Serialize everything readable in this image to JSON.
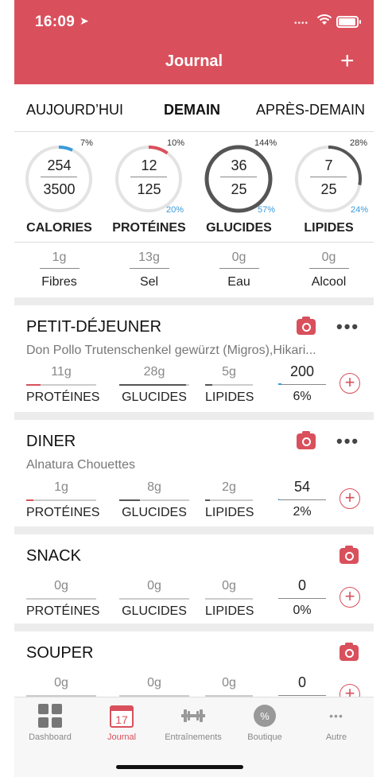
{
  "status": {
    "time": "16:09",
    "signal": "••••"
  },
  "header": {
    "title": "Journal",
    "add_label": "+"
  },
  "tabs": [
    {
      "label": "AUJOURD’HUI"
    },
    {
      "label": "DEMAIN"
    },
    {
      "label": "APRÈS-DEMAIN"
    }
  ],
  "colors": {
    "brand": "#d9505c",
    "accent_blue": "#3a9ad9",
    "ring_track": "#e3e3e3",
    "ring_full": "#555555"
  },
  "summary": [
    {
      "name": "CALORIES",
      "value": "254",
      "goal": "3500",
      "pct_top": "7%",
      "pct_bottom": "",
      "fraction": 0.07,
      "ring_color": "#3a9ad9"
    },
    {
      "name": "PROTÉINES",
      "value": "12",
      "goal": "125",
      "pct_top": "10%",
      "pct_bottom": "20%",
      "fraction": 0.1,
      "ring_color": "#d9505c"
    },
    {
      "name": "GLUCIDES",
      "value": "36",
      "goal": "25",
      "pct_top": "144%",
      "pct_bottom": "57%",
      "fraction": 1.0,
      "ring_color": "#555555"
    },
    {
      "name": "LIPIDES",
      "value": "7",
      "goal": "25",
      "pct_top": "28%",
      "pct_bottom": "24%",
      "fraction": 0.28,
      "ring_color": "#555555"
    }
  ],
  "secondary": [
    {
      "name": "Fibres",
      "value": "1g"
    },
    {
      "name": "Sel",
      "value": "13g"
    },
    {
      "name": "Eau",
      "value": "0g"
    },
    {
      "name": "Alcool",
      "value": "0g"
    }
  ],
  "nutrient_labels": {
    "protein": "PROTÉINES",
    "carbs": "GLUCIDES",
    "fat": "LIPIDES"
  },
  "meals": [
    {
      "title": "PETIT-DÉJEUNER",
      "desc": "Don Pollo Trutenschenkel gewürzt (Migros),Hikari...",
      "protein": "11g",
      "carbs": "28g",
      "fat": "5g",
      "kcal": "200",
      "kcal_pct": "6%",
      "protein_fill": 0.2,
      "carbs_fill": 0.95,
      "fat_fill": 0.15,
      "kcal_fill": 0.06
    },
    {
      "title": "DINER",
      "desc": "Alnatura Chouettes",
      "protein": "1g",
      "carbs": "8g",
      "fat": "2g",
      "kcal": "54",
      "kcal_pct": "2%",
      "protein_fill": 0.1,
      "carbs_fill": 0.3,
      "fat_fill": 0.1,
      "kcal_fill": 0.02
    },
    {
      "title": "SNACK",
      "desc": "",
      "protein": "0g",
      "carbs": "0g",
      "fat": "0g",
      "kcal": "0",
      "kcal_pct": "0%",
      "protein_fill": 0,
      "carbs_fill": 0,
      "fat_fill": 0,
      "kcal_fill": 0
    },
    {
      "title": "SOUPER",
      "desc": "",
      "protein": "0g",
      "carbs": "0g",
      "fat": "0g",
      "kcal": "0",
      "kcal_pct": "",
      "protein_fill": 0,
      "carbs_fill": 0,
      "fat_fill": 0,
      "kcal_fill": 0
    }
  ],
  "bottom_nav": [
    {
      "label": "Dashboard",
      "icon": "dashboard-grid-icon"
    },
    {
      "label": "Journal",
      "icon": "calendar-icon",
      "badge": "17",
      "active": true
    },
    {
      "label": "Entraînements",
      "icon": "dumbbell-icon"
    },
    {
      "label": "Boutique",
      "icon": "percent-badge-icon",
      "badge": "%"
    },
    {
      "label": "Autre",
      "icon": "more-dots-icon",
      "badge": "•••"
    }
  ]
}
